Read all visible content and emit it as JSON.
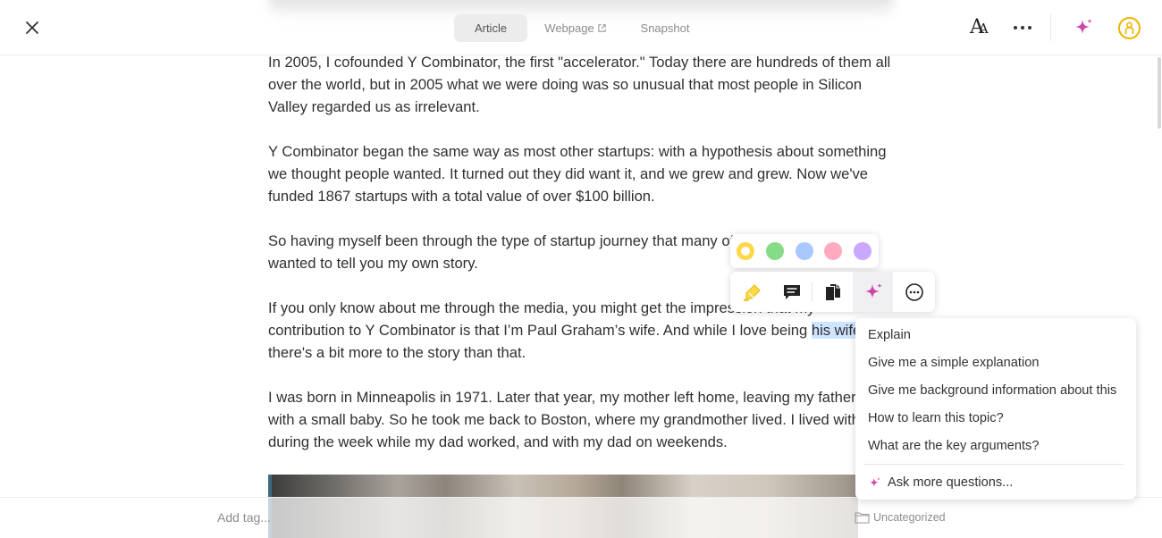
{
  "header": {
    "tabs": [
      "Article",
      "Webpage",
      "Snapshot"
    ],
    "active_tab": "Article"
  },
  "article": {
    "paragraphs": [
      {
        "lines": [
          "In 2005, I cofounded Y Combinator, the first \"accelerator.\" Today there are hundreds of them all",
          "over the world, but in 2005 what we were doing was so unusual that most people in Silicon",
          "Valley regarded us as irrelevant."
        ]
      },
      {
        "lines": [
          "Y Combinator began the same way as most other startups: with a hypothesis about something",
          "we thought people wanted. It turned out they did want it, and we grew and grew. Now we've",
          "funded 1867 startups with a total value of over $100 billion."
        ]
      },
      {
        "lines": [
          "So having myself been through the type of startup journey that many of",
          "wanted to tell you my own story."
        ]
      },
      {
        "lines": [
          "If you only know about me through the media, you might get the impression that my",
          "contribution to Y Combinator is that I’m Paul Graham’s wife. And while I love being ",
          "there's a bit more to the story than that."
        ],
        "highlight": "his wife"
      },
      {
        "lines": [
          "I was born in Minneapolis in 1971. Later that year, my mother left home, leaving my father",
          "with a small baby. So he took me back to Boston, where my grandmother lived.  I lived with",
          "during the week while my dad worked, and with my dad on weekends."
        ]
      }
    ]
  },
  "highlight_colors": [
    "#ffd84a",
    "#86dc86",
    "#a9c8ff",
    "#ffaabf",
    "#c9a8ff"
  ],
  "selected_color": "#ffd84a",
  "toolbar_icons": [
    "highlighter-icon",
    "comment-icon",
    "copy-icon",
    "ai-sparkle-icon",
    "more-options-icon"
  ],
  "ai_menu": {
    "items": [
      "Explain",
      "Give me a simple explanation",
      "Give me background information about this",
      "How to learn this topic?",
      "What are the key arguments?"
    ],
    "ask_more": "Ask more questions..."
  },
  "footer": {
    "tag_placeholder": "Add tag...",
    "folder": "Uncategorized"
  },
  "colors": {
    "accent_sparkle": "#e0409a",
    "avatar_ring": "#f0b400",
    "selection": "#cfe4ff"
  }
}
